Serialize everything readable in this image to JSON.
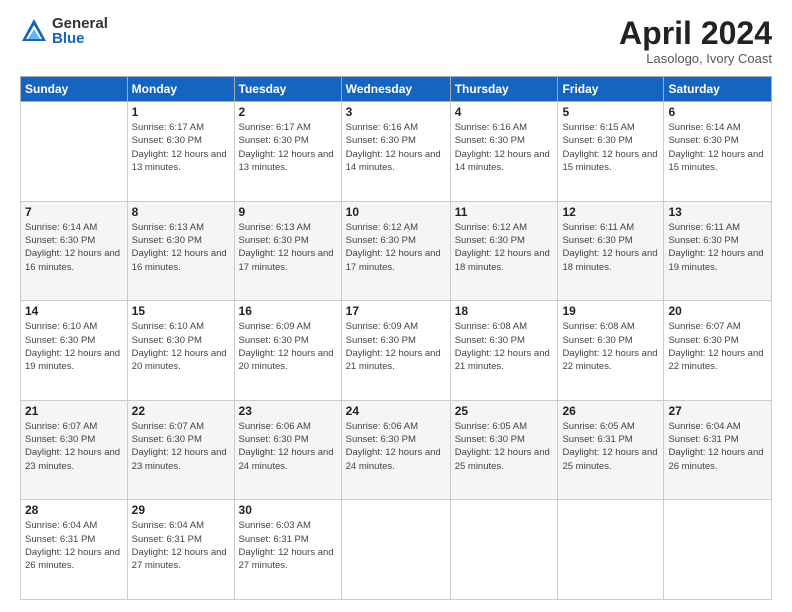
{
  "header": {
    "logo_general": "General",
    "logo_blue": "Blue",
    "month_title": "April 2024",
    "location": "Lasologo, Ivory Coast"
  },
  "days_of_week": [
    "Sunday",
    "Monday",
    "Tuesday",
    "Wednesday",
    "Thursday",
    "Friday",
    "Saturday"
  ],
  "weeks": [
    [
      null,
      {
        "day": 1,
        "sunrise": "6:17 AM",
        "sunset": "6:30 PM",
        "daylight": "12 hours and 13 minutes."
      },
      {
        "day": 2,
        "sunrise": "6:17 AM",
        "sunset": "6:30 PM",
        "daylight": "12 hours and 13 minutes."
      },
      {
        "day": 3,
        "sunrise": "6:16 AM",
        "sunset": "6:30 PM",
        "daylight": "12 hours and 14 minutes."
      },
      {
        "day": 4,
        "sunrise": "6:16 AM",
        "sunset": "6:30 PM",
        "daylight": "12 hours and 14 minutes."
      },
      {
        "day": 5,
        "sunrise": "6:15 AM",
        "sunset": "6:30 PM",
        "daylight": "12 hours and 15 minutes."
      },
      {
        "day": 6,
        "sunrise": "6:14 AM",
        "sunset": "6:30 PM",
        "daylight": "12 hours and 15 minutes."
      }
    ],
    [
      {
        "day": 7,
        "sunrise": "6:14 AM",
        "sunset": "6:30 PM",
        "daylight": "12 hours and 16 minutes."
      },
      {
        "day": 8,
        "sunrise": "6:13 AM",
        "sunset": "6:30 PM",
        "daylight": "12 hours and 16 minutes."
      },
      {
        "day": 9,
        "sunrise": "6:13 AM",
        "sunset": "6:30 PM",
        "daylight": "12 hours and 17 minutes."
      },
      {
        "day": 10,
        "sunrise": "6:12 AM",
        "sunset": "6:30 PM",
        "daylight": "12 hours and 17 minutes."
      },
      {
        "day": 11,
        "sunrise": "6:12 AM",
        "sunset": "6:30 PM",
        "daylight": "12 hours and 18 minutes."
      },
      {
        "day": 12,
        "sunrise": "6:11 AM",
        "sunset": "6:30 PM",
        "daylight": "12 hours and 18 minutes."
      },
      {
        "day": 13,
        "sunrise": "6:11 AM",
        "sunset": "6:30 PM",
        "daylight": "12 hours and 19 minutes."
      }
    ],
    [
      {
        "day": 14,
        "sunrise": "6:10 AM",
        "sunset": "6:30 PM",
        "daylight": "12 hours and 19 minutes."
      },
      {
        "day": 15,
        "sunrise": "6:10 AM",
        "sunset": "6:30 PM",
        "daylight": "12 hours and 20 minutes."
      },
      {
        "day": 16,
        "sunrise": "6:09 AM",
        "sunset": "6:30 PM",
        "daylight": "12 hours and 20 minutes."
      },
      {
        "day": 17,
        "sunrise": "6:09 AM",
        "sunset": "6:30 PM",
        "daylight": "12 hours and 21 minutes."
      },
      {
        "day": 18,
        "sunrise": "6:08 AM",
        "sunset": "6:30 PM",
        "daylight": "12 hours and 21 minutes."
      },
      {
        "day": 19,
        "sunrise": "6:08 AM",
        "sunset": "6:30 PM",
        "daylight": "12 hours and 22 minutes."
      },
      {
        "day": 20,
        "sunrise": "6:07 AM",
        "sunset": "6:30 PM",
        "daylight": "12 hours and 22 minutes."
      }
    ],
    [
      {
        "day": 21,
        "sunrise": "6:07 AM",
        "sunset": "6:30 PM",
        "daylight": "12 hours and 23 minutes."
      },
      {
        "day": 22,
        "sunrise": "6:07 AM",
        "sunset": "6:30 PM",
        "daylight": "12 hours and 23 minutes."
      },
      {
        "day": 23,
        "sunrise": "6:06 AM",
        "sunset": "6:30 PM",
        "daylight": "12 hours and 24 minutes."
      },
      {
        "day": 24,
        "sunrise": "6:06 AM",
        "sunset": "6:30 PM",
        "daylight": "12 hours and 24 minutes."
      },
      {
        "day": 25,
        "sunrise": "6:05 AM",
        "sunset": "6:30 PM",
        "daylight": "12 hours and 25 minutes."
      },
      {
        "day": 26,
        "sunrise": "6:05 AM",
        "sunset": "6:31 PM",
        "daylight": "12 hours and 25 minutes."
      },
      {
        "day": 27,
        "sunrise": "6:04 AM",
        "sunset": "6:31 PM",
        "daylight": "12 hours and 26 minutes."
      }
    ],
    [
      {
        "day": 28,
        "sunrise": "6:04 AM",
        "sunset": "6:31 PM",
        "daylight": "12 hours and 26 minutes."
      },
      {
        "day": 29,
        "sunrise": "6:04 AM",
        "sunset": "6:31 PM",
        "daylight": "12 hours and 27 minutes."
      },
      {
        "day": 30,
        "sunrise": "6:03 AM",
        "sunset": "6:31 PM",
        "daylight": "12 hours and 27 minutes."
      },
      null,
      null,
      null,
      null
    ]
  ]
}
